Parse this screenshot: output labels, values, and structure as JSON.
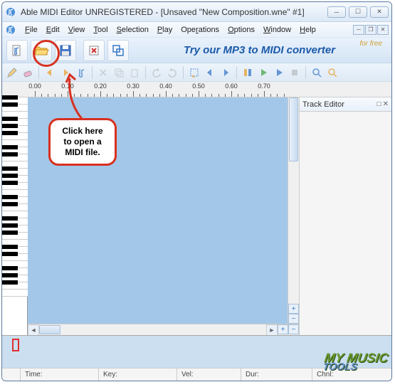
{
  "title": "Able MIDI Editor UNREGISTERED - [Unsaved \"New Composition.wne\" #1]",
  "menu": {
    "file": "File",
    "edit": "Edit",
    "view": "View",
    "tool": "Tool",
    "selection": "Selection",
    "play": "Play",
    "operations": "Operations",
    "options": "Options",
    "window": "Window",
    "help": "Help"
  },
  "banner": {
    "text": "Try our MP3 to MIDI converter",
    "sub": "for free"
  },
  "ruler": {
    "ticks": [
      "0.00",
      "0.10",
      "0.20",
      "0.30",
      "0.40",
      "0.50",
      "0.60",
      "0.70"
    ]
  },
  "track_panel": {
    "title": "Track Editor"
  },
  "status": {
    "time_label": "Time:",
    "key_label": "Key:",
    "vel_label": "Vel:",
    "dur_label": "Dur:",
    "chnl_label": "Chnl:"
  },
  "callout": {
    "line1": "Click here",
    "line2": "to open a",
    "line3": "MIDI file."
  },
  "watermark": {
    "line1": "MY MUSIC",
    "line2": "TOOLS"
  },
  "icons": {
    "new": "new-file-icon",
    "open": "open-folder-icon",
    "save": "save-icon",
    "delete": "delete-icon",
    "windows": "windows-icon"
  }
}
